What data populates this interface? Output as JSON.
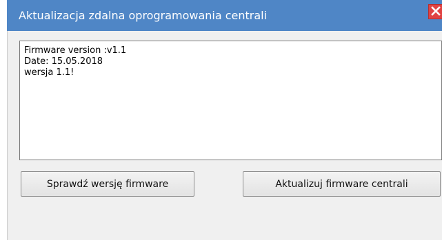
{
  "window": {
    "title": "Aktualizacja zdalna oprogramowania centrali",
    "close_icon": "close-icon",
    "colors": {
      "titlebar": "#4f86c6",
      "close": "#e04343",
      "background": "#f0f0f0"
    }
  },
  "firmware_info": {
    "lines": [
      "Firmware version :v1.1",
      "Date: 15.05.2018",
      "wersja 1.1!"
    ]
  },
  "buttons": {
    "check_version": "Sprawdź wersję firmware",
    "update_firmware": "Aktualizuj firmware centrali"
  }
}
